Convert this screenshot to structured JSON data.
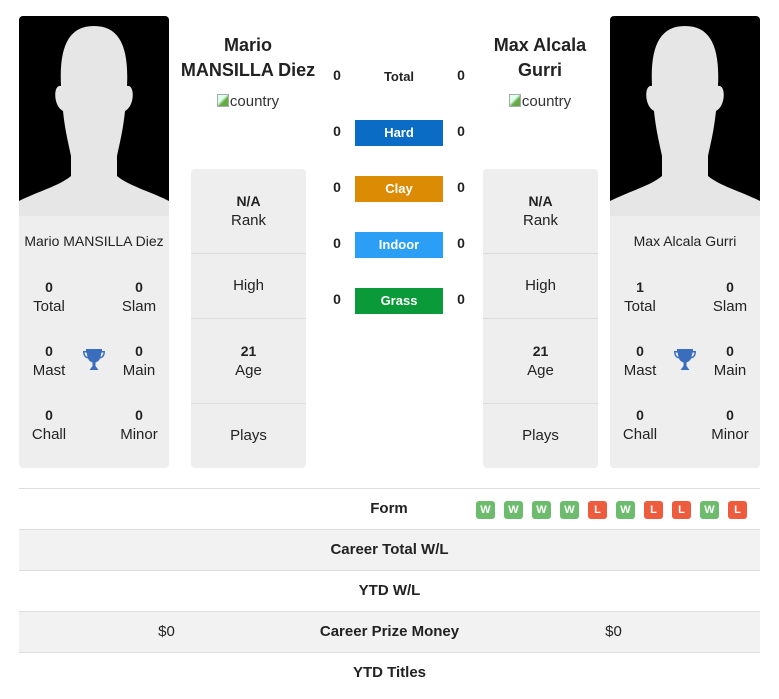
{
  "player1": {
    "name": "Mario MANSILLA Diez",
    "name_line1": "Mario",
    "name_line2": "MANSILLA Diez",
    "flag_alt": "country",
    "rank": "N/A",
    "rank_label": "Rank",
    "high_label": "High",
    "age": "21",
    "age_label": "Age",
    "plays_label": "Plays",
    "titles": {
      "total": "0",
      "total_label": "Total",
      "slam": "0",
      "slam_label": "Slam",
      "mast": "0",
      "mast_label": "Mast",
      "main": "0",
      "main_label": "Main",
      "chall": "0",
      "chall_label": "Chall",
      "minor": "0",
      "minor_label": "Minor"
    }
  },
  "player2": {
    "name": "Max Alcala Gurri",
    "name_line1": "Max Alcala",
    "name_line2": "Gurri",
    "flag_alt": "country",
    "rank": "N/A",
    "rank_label": "Rank",
    "high_label": "High",
    "age": "21",
    "age_label": "Age",
    "plays_label": "Plays",
    "titles": {
      "total": "1",
      "total_label": "Total",
      "slam": "0",
      "slam_label": "Slam",
      "mast": "0",
      "mast_label": "Mast",
      "main": "0",
      "main_label": "Main",
      "chall": "0",
      "chall_label": "Chall",
      "minor": "0",
      "minor_label": "Minor"
    }
  },
  "h2h": {
    "total": {
      "label": "Total",
      "p1": "0",
      "p2": "0"
    },
    "surfaces": [
      {
        "label": "Hard",
        "p1": "0",
        "p2": "0",
        "color": "#0a6cc4"
      },
      {
        "label": "Clay",
        "p1": "0",
        "p2": "0",
        "color": "#dc8b05"
      },
      {
        "label": "Indoor",
        "p1": "0",
        "p2": "0",
        "color": "#2b9ff5"
      },
      {
        "label": "Grass",
        "p1": "0",
        "p2": "0",
        "color": "#0a9a3a"
      }
    ]
  },
  "table": {
    "form_label": "Form",
    "form": [
      "W",
      "W",
      "W",
      "W",
      "L",
      "W",
      "L",
      "L",
      "W",
      "L"
    ],
    "career_wl_label": "Career Total W/L",
    "ytd_wl_label": "YTD W/L",
    "prize_label": "Career Prize Money",
    "prize_p1": "$0",
    "prize_p2": "$0",
    "ytd_titles_label": "YTD Titles"
  }
}
